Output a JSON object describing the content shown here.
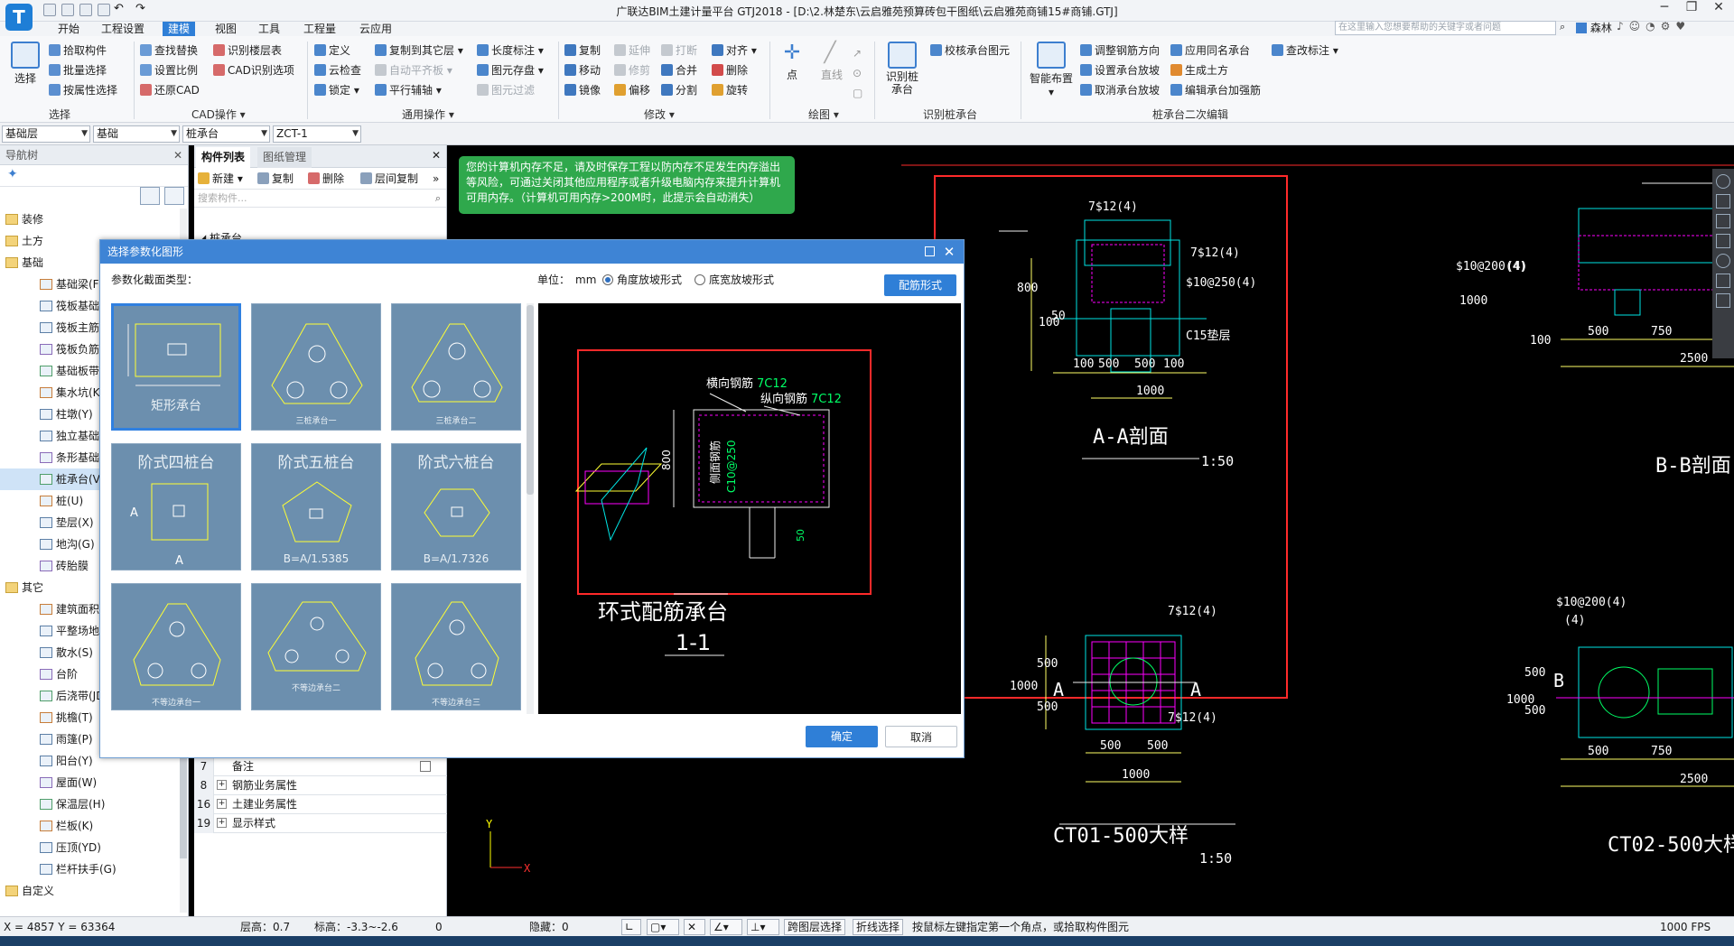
{
  "window": {
    "title": "广联达BIM土建计量平台 GTJ2018 - [D:\\2.林楚东\\云启雅苑预算砖包干图纸\\云启雅苑商铺15#商铺.GTJ]",
    "logo": "T"
  },
  "menu": {
    "tabs": [
      "开始",
      "工程设置",
      "建模",
      "视图",
      "工具",
      "工程量",
      "云应用"
    ],
    "help_placeholder": "在这里输入您想要帮助的关键字或者问题",
    "user": "森林"
  },
  "ribbon": {
    "select_group": {
      "big": "选择",
      "items": [
        "拾取构件",
        "批量选择",
        "按属性选择"
      ],
      "label": "选择"
    },
    "cad_group": {
      "items": [
        "查找替换",
        "识别楼层表",
        "设置比例",
        "CAD识别选项",
        "还原CAD"
      ],
      "label": "CAD操作"
    },
    "common_group": {
      "items": [
        "定义",
        "复制到其它层",
        "长度标注",
        "云检查",
        "自动平齐板",
        "图元存盘",
        "锁定",
        "平行辅轴",
        "图元过滤"
      ],
      "label": "通用操作"
    },
    "modify_group": {
      "items": [
        "复制",
        "延伸",
        "打断",
        "对齐",
        "移动",
        "修剪",
        "合并",
        "删除",
        "镜像",
        "偏移",
        "分割",
        "旋转"
      ],
      "label": "修改"
    },
    "draw_group": {
      "items": [
        "点",
        "直线"
      ],
      "label": "绘图"
    },
    "identify_group": {
      "big": "识别桩承台",
      "items": [
        "校核承台图元"
      ],
      "label": "识别桩承台"
    },
    "edit_group": {
      "big": "智能布置",
      "items": [
        "调整钢筋方向",
        "应用同名承台",
        "查改标注",
        "设置承台放坡",
        "生成土方",
        "取消承台放坡",
        "编辑承台加强筋"
      ],
      "label": "桩承台二次编辑"
    }
  },
  "filters": {
    "layer": "基础层",
    "category": "基础",
    "type": "桩承台",
    "name": "ZCT-1"
  },
  "nav": {
    "header": "导航树",
    "items": [
      {
        "label": "装修",
        "level": 0
      },
      {
        "label": "土方",
        "level": 0
      },
      {
        "label": "基础",
        "level": 0
      },
      {
        "label": "基础梁(F)",
        "level": 1
      },
      {
        "label": "筏板基础(M)",
        "level": 1
      },
      {
        "label": "筏板主筋(R)",
        "level": 1
      },
      {
        "label": "筏板负筋(X)",
        "level": 1
      },
      {
        "label": "基础板带(W)",
        "level": 1
      },
      {
        "label": "集水坑(K)",
        "level": 1
      },
      {
        "label": "柱墩(Y)",
        "level": 1
      },
      {
        "label": "独立基础(D)",
        "level": 1
      },
      {
        "label": "条形基础(T)",
        "level": 1
      },
      {
        "label": "桩承台(V)",
        "level": 1,
        "selected": true
      },
      {
        "label": "桩(U)",
        "level": 1
      },
      {
        "label": "垫层(X)",
        "level": 1
      },
      {
        "label": "地沟(G)",
        "level": 1
      },
      {
        "label": "砖胎膜",
        "level": 1
      },
      {
        "label": "其它",
        "level": 0
      },
      {
        "label": "建筑面积(U)",
        "level": 1
      },
      {
        "label": "平整场地(V)",
        "level": 1
      },
      {
        "label": "散水(S)",
        "level": 1
      },
      {
        "label": "台阶",
        "level": 1
      },
      {
        "label": "后浇带(JD)",
        "level": 1
      },
      {
        "label": "挑檐(T)",
        "level": 1
      },
      {
        "label": "雨篷(P)",
        "level": 1
      },
      {
        "label": "阳台(Y)",
        "level": 1
      },
      {
        "label": "屋面(W)",
        "level": 1
      },
      {
        "label": "保温层(H)",
        "level": 1
      },
      {
        "label": "栏板(K)",
        "level": 1
      },
      {
        "label": "压顶(YD)",
        "level": 1
      },
      {
        "label": "栏杆扶手(G)",
        "level": 1
      },
      {
        "label": "自定义",
        "level": 0
      }
    ]
  },
  "components": {
    "tabs": [
      "构件列表",
      "图纸管理"
    ],
    "commands": [
      "新建",
      "复制",
      "删除",
      "层间复制"
    ],
    "search_placeholder": "搜索构件...",
    "first_item": "桩承台",
    "props": [
      {
        "num": "7",
        "name": "备注"
      },
      {
        "num": "8",
        "name": "钢筋业务属性"
      },
      {
        "num": "16",
        "name": "土建业务属性"
      },
      {
        "num": "19",
        "name": "显示样式"
      }
    ]
  },
  "notification": "您的计算机内存不足，请及时保存工程以防内存不足发生内存溢出等风险，可通过关闭其他应用程序或者升级电脑内存来提升计算机可用内存。（计算机可用内存>200M时，此提示会自动消失）",
  "dialog": {
    "title": "选择参数化图形",
    "type_label": "参数化截面类型：",
    "unit_label": "单位：",
    "unit_value": "mm",
    "radio_angle": "角度放坡形式",
    "radio_width": "底宽放坡形式",
    "rebar_button": "配筋形式",
    "ok": "确定",
    "cancel": "取消",
    "shapes": [
      {
        "label": "矩形承台",
        "selected": true
      },
      {
        "label": "三桩承台一"
      },
      {
        "label": "三桩承台二"
      },
      {
        "label": "阶式四桩台",
        "sub": ""
      },
      {
        "label": "阶式五桩台",
        "sub": "B=A/1.5385"
      },
      {
        "label": "阶式六桩台",
        "sub": "B=A/1.7326"
      },
      {
        "label": "不等边承台一"
      },
      {
        "label": "不等边承台二"
      },
      {
        "label": "不等边承台三"
      }
    ],
    "preview": {
      "title": "环式配筋承台",
      "section": "1-1",
      "h_rebar": "横向钢筋",
      "h_rebar_val": "7C12",
      "v_rebar": "纵向钢筋",
      "v_rebar_val": "7C12",
      "side_rebar": "侧面钢筋",
      "side_rebar_val": "C10@250",
      "height": "800",
      "cover": "50"
    }
  },
  "drawing": {
    "aa_title": "A-A剖面",
    "aa_scale": "1:50",
    "bb_title": "B-B剖面",
    "ct01": "CT01-500大样",
    "ct01_scale": "1:50",
    "ct02": "CT02-500大样",
    "labels": [
      "7$12(4)",
      "7$12(4)",
      "$10@250(4)",
      "C15垫层",
      "$10@200(4)",
      "(4)",
      "7$12(4)",
      "7$12(4)",
      "$10@200(4)",
      "(4)"
    ],
    "dims": [
      "800",
      "100",
      "50",
      "100",
      "500",
      "500",
      "100",
      "1000",
      "1000",
      "100",
      "500",
      "750",
      "2500",
      "500",
      "500",
      "500",
      "500",
      "1000",
      "1000",
      "500",
      "750",
      "2500",
      "500",
      "500",
      "1000"
    ],
    "markA": "A",
    "markB": "B"
  },
  "status": {
    "coords": "X = 4857 Y = 63364",
    "floor_height": "层高：0.7",
    "elevation": "标高：-3.3~-2.6",
    "zero": "0",
    "hidden": "隐藏：0",
    "cross_layer": "跨图层选择",
    "polyline": "折线选择",
    "hint": "按鼠标左键指定第一个角点，或拾取构件图元",
    "fps": "1000 FPS"
  },
  "colors": {
    "accent": "#2f7fd7",
    "notify": "#2fa84c",
    "cad_red": "#ff2a2a",
    "cad_magenta": "#ff00ff",
    "cad_cyan": "#00e5e5"
  }
}
